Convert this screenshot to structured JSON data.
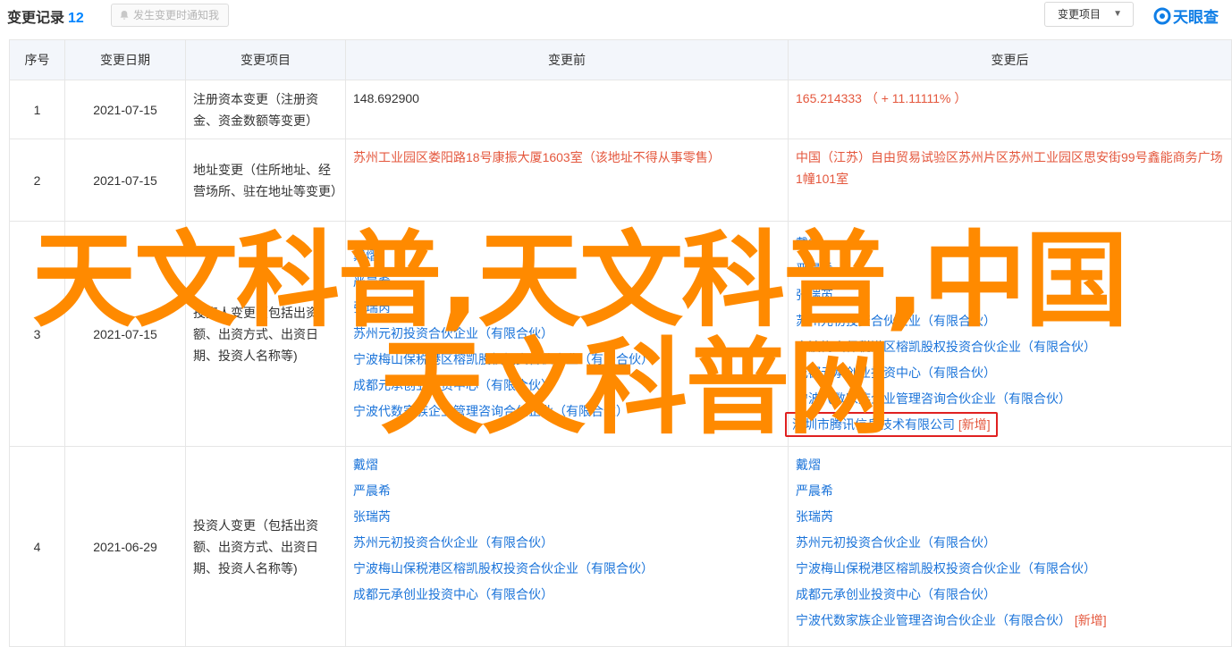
{
  "header": {
    "title": "变更记录",
    "count": "12",
    "notify_label": "发生变更时通知我",
    "select_label": "变更项目",
    "logo_text": "天眼查"
  },
  "table": {
    "columns": [
      "序号",
      "变更日期",
      "变更项目",
      "变更前",
      "变更后"
    ],
    "rows": [
      {
        "no": "1",
        "date": "2021-07-15",
        "item": "注册资本变更（注册资金、资金数额等变更）",
        "before": "148.692900",
        "after": "165.214333 （ + 11.11111% ）"
      },
      {
        "no": "2",
        "date": "2021-07-15",
        "item": "地址变更（住所地址、经营场所、驻在地址等变更）",
        "before": "苏州工业园区娄阳路18号康振大厦1603室（该地址不得从事零售）",
        "after": "中国（江苏）自由贸易试验区苏州片区苏州工业园区思安街99号鑫能商务广场1幢101室"
      },
      {
        "no": "3",
        "date": "2021-07-15",
        "item": "投资人变更（包括出资额、出资方式、出资日期、投资人名称等)",
        "before": [
          "戴熠",
          "严晨希",
          "张瑞芮",
          "苏州元初投资合伙企业（有限合伙）",
          "宁波梅山保税港区榕凯股权投资合伙企业（有限合伙）",
          "成都元承创业投资中心（有限合伙）",
          "宁波代数家族企业管理咨询合伙企业（有限合伙）"
        ],
        "after": [
          "戴熠",
          "严晨希",
          "张瑞芮",
          "苏州元初投资合伙企业（有限合伙）",
          "宁波梅山保税港区榕凯股权投资合伙企业（有限合伙）",
          "成都元承创业投资中心（有限合伙）",
          "宁波代数家族企业管理咨询合伙企业（有限合伙）"
        ],
        "after_new": "深圳市腾讯信息技术有限公司",
        "new_tag": "[新增]"
      },
      {
        "no": "4",
        "date": "2021-06-29",
        "item": "投资人变更（包括出资额、出资方式、出资日期、投资人名称等)",
        "before": [
          "戴熠",
          "严晨希",
          "张瑞芮",
          "苏州元初投资合伙企业（有限合伙）",
          "宁波梅山保税港区榕凯股权投资合伙企业（有限合伙）",
          "成都元承创业投资中心（有限合伙）"
        ],
        "after": [
          "戴熠",
          "严晨希",
          "张瑞芮",
          "苏州元初投资合伙企业（有限合伙）",
          "宁波梅山保税港区榕凯股权投资合伙企业（有限合伙）",
          "成都元承创业投资中心（有限合伙）"
        ],
        "after_new": "宁波代数家族企业管理咨询合伙企业（有限合伙）",
        "new_tag": "[新增]"
      }
    ]
  },
  "watermark": {
    "line1": "天文科普,天文科普,中国",
    "line2": "天文科普网"
  },
  "colors": {
    "accent": "#0084ff",
    "link": "#1a73d9",
    "changed": "#e4573d",
    "watermark": "#ff8a00"
  }
}
